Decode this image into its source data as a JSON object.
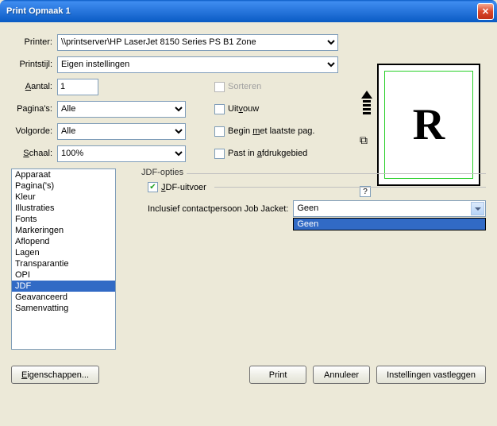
{
  "window": {
    "title": "Print Opmaak 1"
  },
  "labels": {
    "printer": "Printer:",
    "printstijl": "Printstijl:",
    "aantal": "Aantal:",
    "paginas": "Pagina's:",
    "volgorde": "Volgorde:",
    "schaal": "Schaal:"
  },
  "fields": {
    "printer": "\\\\printserver\\HP LaserJet 8150 Series PS  B1 Zone",
    "printstijl": "Eigen instellingen",
    "aantal": "1",
    "paginas": "Alle",
    "volgorde": "Alle",
    "schaal": "100%"
  },
  "checks": {
    "sorteren": "Sorteren",
    "uitvouw": "Uitvouw",
    "begin_laatste": "Begin met laatste pag.",
    "past_gebied": "Past in afdrukgebied"
  },
  "preview": {
    "glyph": "R",
    "help": "?"
  },
  "listbox": {
    "items": [
      "Apparaat",
      "Pagina('s)",
      "Kleur",
      "Illustraties",
      "Fonts",
      "Markeringen",
      "Aflopend",
      "Lagen",
      "Transparantie",
      "OPI",
      "JDF",
      "Geavanceerd",
      "Samenvatting"
    ],
    "selected_index": 10
  },
  "jdf": {
    "group_label": "JDF-opties",
    "uitvoer_label": "JDF-uitvoer",
    "uitvoer_checked": true,
    "contact_label": "Inclusief contactpersoon Job Jacket:",
    "contact_value": "Geen",
    "contact_options": [
      "Geen"
    ]
  },
  "buttons": {
    "eigenschappen": "Eigenschappen...",
    "print": "Print",
    "annuleer": "Annuleer",
    "instellingen": "Instellingen vastleggen"
  }
}
